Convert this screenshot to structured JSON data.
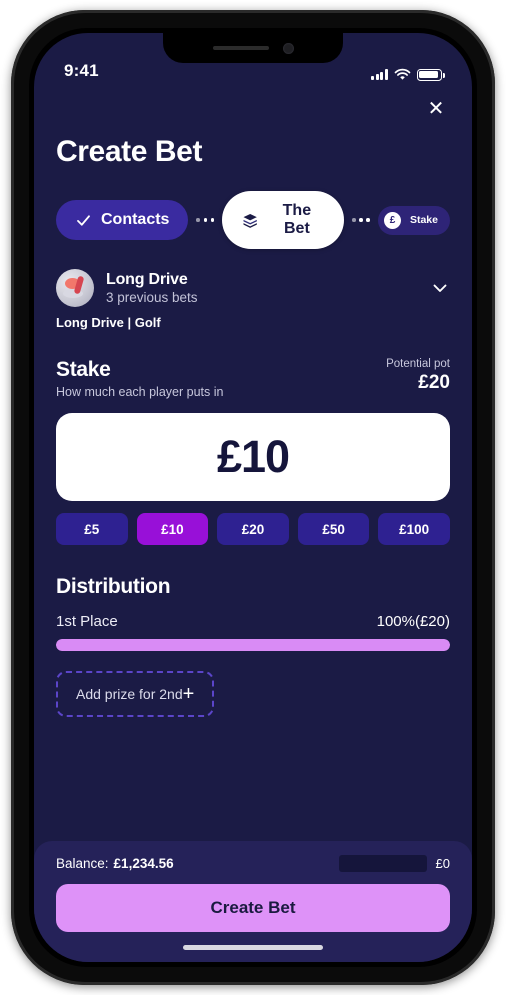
{
  "status_bar": {
    "time": "9:41",
    "signal_icon": "cellular-bars-icon",
    "wifi_icon": "wifi-icon",
    "battery_icon": "battery-full-icon"
  },
  "header": {
    "close_label": "✕",
    "title": "Create Bet"
  },
  "steps": [
    {
      "label": "Contacts",
      "state": "done",
      "icon": "check-icon"
    },
    {
      "label": "The Bet",
      "state": "active",
      "icon": "money-stack-icon"
    },
    {
      "label": "Stake",
      "state": "todo",
      "icon": "pound-coin-icon"
    }
  ],
  "bet": {
    "avatar": "golf-avatar-icon",
    "name": "Long Drive",
    "previous_bets": "3 previous bets",
    "chevron": "chevron-down-icon",
    "tag": "Long Drive | Golf"
  },
  "stake": {
    "title": "Stake",
    "subtitle": "How much each player puts in",
    "pot_label": "Potential pot",
    "pot_value": "£20",
    "amount": "£10",
    "quick_amounts": [
      {
        "label": "£5",
        "selected": false
      },
      {
        "label": "£10",
        "selected": true
      },
      {
        "label": "£20",
        "selected": false
      },
      {
        "label": "£50",
        "selected": false
      },
      {
        "label": "£100",
        "selected": false
      }
    ]
  },
  "distribution": {
    "title": "Distribution",
    "rows": [
      {
        "place": "1st Place",
        "share": "100%(£20)",
        "percent": 100
      }
    ],
    "add_prize_label": "Add prize for 2nd",
    "add_prize_icon": "plus-icon"
  },
  "bottom": {
    "balance_label": "Balance:",
    "balance_value": "£1,234.56",
    "secondary_value": "£0",
    "cta_label": "Create Bet"
  },
  "colors": {
    "screen_bg": "#1B1B45",
    "bottom_bar_bg": "#252259",
    "accent_pink": "#DE92F8",
    "bar_fill": "#D98BF5",
    "chip_selected": "#9810D8",
    "chip_idle": "#2E2191",
    "pill_done": "#3A2BA0",
    "dashed_border": "#5B45C9"
  }
}
